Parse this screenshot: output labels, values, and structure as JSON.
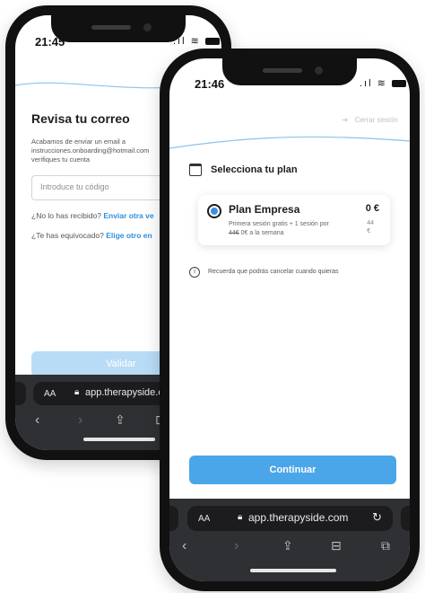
{
  "back_phone": {
    "time": "21:45",
    "title": "Revisa tu correo",
    "description_line1": "Acabamos de enviar un email a",
    "description_line2": "instrucciones.onboarding@hotmail.com",
    "description_line3": "verifiques tu cuenta",
    "code_placeholder": "Introduce tu código",
    "resend_prefix": "¿No lo has recibido?",
    "resend_link": "Enviar otra ve",
    "mistake_prefix": "¿Te has equivocado?",
    "mistake_link": "Elige otro en",
    "validate_button": "Validar",
    "url_aa": "AA",
    "url": "app.therapyside.com"
  },
  "front_phone": {
    "time": "21:46",
    "logout": "Cerrar sesión",
    "section_title": "Selecciona tu plan",
    "plan_name": "Plan Empresa",
    "plan_price": "0 €",
    "plan_desc_line1": "Primera sesión gratis + 1 sesión por",
    "plan_desc_strike": "44€",
    "plan_desc_rest": "0€ a la semana",
    "plan_old_price": "44",
    "plan_old_currency": "€",
    "note": "Recuerda que podrás cancelar cuando quieras",
    "continue_button": "Continuar",
    "url_aa": "AA",
    "url": "app.therapyside.com"
  },
  "colors": {
    "primary": "#4aa6e8",
    "primary_disabled": "#b9dcf6",
    "link": "#2f8fe0",
    "wave": "#8cc3ea"
  },
  "icons": [
    "lock-icon",
    "reload-icon",
    "back-icon",
    "forward-icon",
    "share-icon",
    "bookmarks-icon",
    "tabs-icon",
    "calendar-icon",
    "info-icon",
    "logout-icon"
  ]
}
